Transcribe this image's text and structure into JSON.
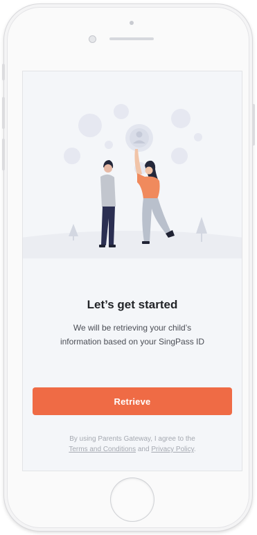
{
  "onboarding": {
    "title": "Let’s get started",
    "subtitle_line1": "We will be retrieving your child’s",
    "subtitle_line2": "information based on your SingPass ID",
    "retrieve_label": "Retrieve",
    "legal_prefix": "By using Parents Gateway, I agree to the",
    "terms_link": "Terms and Conditions",
    "legal_and": " and ",
    "privacy_link": "Privacy Policy",
    "legal_suffix": "."
  },
  "colors": {
    "accent": "#ef6b45",
    "bubble": "#e6e8f1",
    "ground": "#ebedf2",
    "screen_bg": "#f4f6f9"
  },
  "icons": [
    "app-frame",
    "avatar-bubble-icon",
    "tree-icon",
    "home-button"
  ]
}
